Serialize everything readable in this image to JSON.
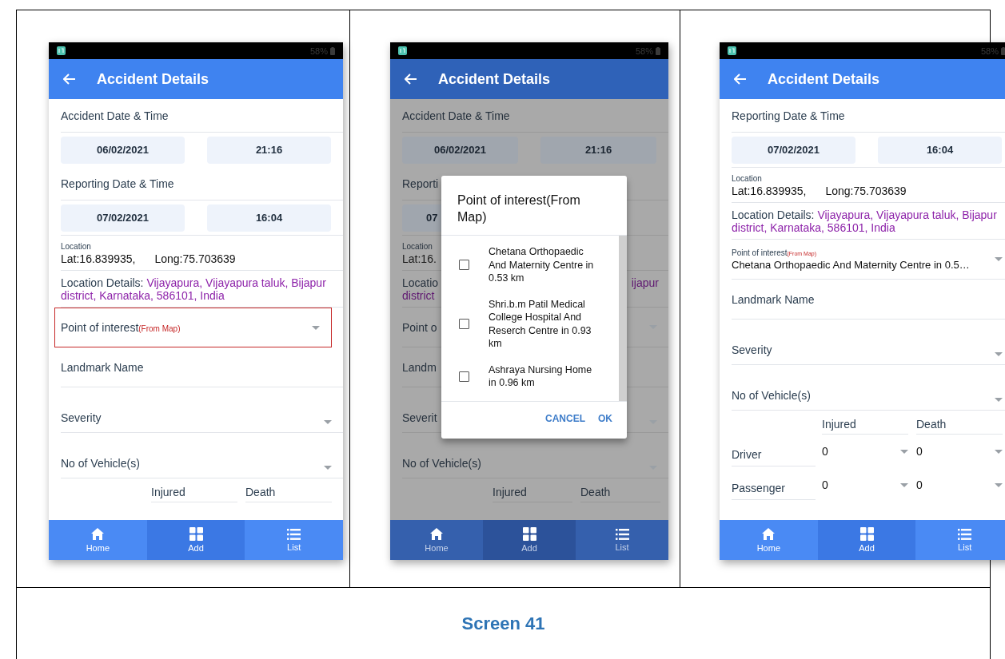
{
  "screens": [
    {
      "status_bar": {
        "battery": "58%"
      },
      "app_bar": {
        "title": "Accident Details"
      },
      "fields": [
        {
          "kind": "heading",
          "text": "Accident Date & Time"
        },
        {
          "kind": "datetime",
          "date": "06/02/2021",
          "time": "21:16"
        },
        {
          "kind": "heading",
          "text": "Reporting Date & Time"
        },
        {
          "kind": "datetime",
          "date": "07/02/2021",
          "time": "16:04"
        },
        {
          "kind": "location",
          "label": "Location",
          "lat": "Lat:16.839935,",
          "long": "Long:75.703639"
        },
        {
          "kind": "details",
          "label": "Location Details:",
          "value": "Vijayapura, Vijayapura taluk, Bijapur district, Karnataka, 586101, India"
        },
        {
          "kind": "picker",
          "label": "Point of interest",
          "hint": "(From Map)",
          "highlighted": true
        },
        {
          "kind": "input",
          "label": "Landmark Name"
        },
        {
          "kind": "select",
          "label": "Severity"
        },
        {
          "kind": "select",
          "label": "No of Vehicle(s)"
        }
      ],
      "casualties": {
        "columns": [
          "Injured",
          "Death"
        ]
      },
      "bottom_nav": [
        {
          "kind": "home",
          "label": "Home",
          "selected": false
        },
        {
          "kind": "grid",
          "label": "Add",
          "selected": true
        },
        {
          "kind": "list",
          "label": "List",
          "selected": false
        }
      ]
    },
    {
      "status_bar": {
        "battery": "58%"
      },
      "app_bar": {
        "title": "Accident Details"
      },
      "fields": [
        {
          "kind": "heading",
          "text": "Accident Date & Time"
        },
        {
          "kind": "datetime",
          "date": "06/02/2021",
          "time": "21:16"
        },
        {
          "kind": "heading",
          "text": "Reporti"
        },
        {
          "kind": "datetime",
          "date": "07"
        },
        {
          "kind": "location",
          "label": "Location",
          "lat": "Lat:16."
        },
        {
          "kind": "partial_details",
          "label": "Locatio",
          "value": "district",
          "trailing": "ijapur"
        },
        {
          "kind": "picker",
          "label": "Point o",
          "highlighted": false
        },
        {
          "kind": "input",
          "label": "Landm"
        },
        {
          "kind": "select",
          "label": "Severit"
        },
        {
          "kind": "select",
          "label": "No of Vehicle(s)"
        }
      ],
      "casualties": {
        "columns": [
          "Injured",
          "Death"
        ]
      },
      "dialog": {
        "title": "Point of interest(From Map)",
        "options": [
          {
            "text": "Chetana Orthopaedic And Maternity Centre in 0.53 km",
            "checked": false
          },
          {
            "text": "Shri.b.m Patil Medical College Hospital And Reserch Centre in 0.93 km",
            "checked": false
          },
          {
            "text": "Ashraya Nursing Home in 0.96 km",
            "checked": false
          }
        ],
        "buttons": [
          "CANCEL",
          "OK"
        ]
      },
      "bottom_nav": [
        {
          "kind": "home",
          "label": "Home",
          "selected": false
        },
        {
          "kind": "grid",
          "label": "Add",
          "selected": true
        },
        {
          "kind": "list",
          "label": "List",
          "selected": false
        }
      ]
    },
    {
      "status_bar": {
        "battery": "58%"
      },
      "app_bar": {
        "title": "Accident Details"
      },
      "fields": [
        {
          "kind": "heading",
          "text": "Reporting Date & Time"
        },
        {
          "kind": "datetime",
          "date": "07/02/2021",
          "time": "16:04"
        },
        {
          "kind": "location",
          "label": "Location",
          "lat": "Lat:16.839935,",
          "long": "Long:75.703639"
        },
        {
          "kind": "details",
          "label": "Location Details:",
          "value": "Vijayapura, Vijayapura taluk, Bijapur district, Karnataka, 586101, India"
        },
        {
          "kind": "picker",
          "label": "Point of interest",
          "hint": "(From Map)",
          "value": "Chetana Orthopaedic And Maternity Centre in 0.5…",
          "highlighted": false
        },
        {
          "kind": "input",
          "label": "Landmark Name"
        },
        {
          "kind": "select",
          "label": "Severity"
        },
        {
          "kind": "select",
          "label": "No of Vehicle(s)"
        }
      ],
      "casualties": {
        "columns": [
          "Injured",
          "Death"
        ],
        "rows": [
          {
            "label": "Driver",
            "injured": "0",
            "death": "0"
          },
          {
            "label": "Passenger",
            "injured": "0",
            "death": "0"
          }
        ]
      },
      "bottom_nav": [
        {
          "kind": "home",
          "label": "Home",
          "selected": false
        },
        {
          "kind": "grid",
          "label": "Add",
          "selected": true
        },
        {
          "kind": "list",
          "label": "List",
          "selected": false
        }
      ]
    }
  ],
  "caption": "Screen 41"
}
